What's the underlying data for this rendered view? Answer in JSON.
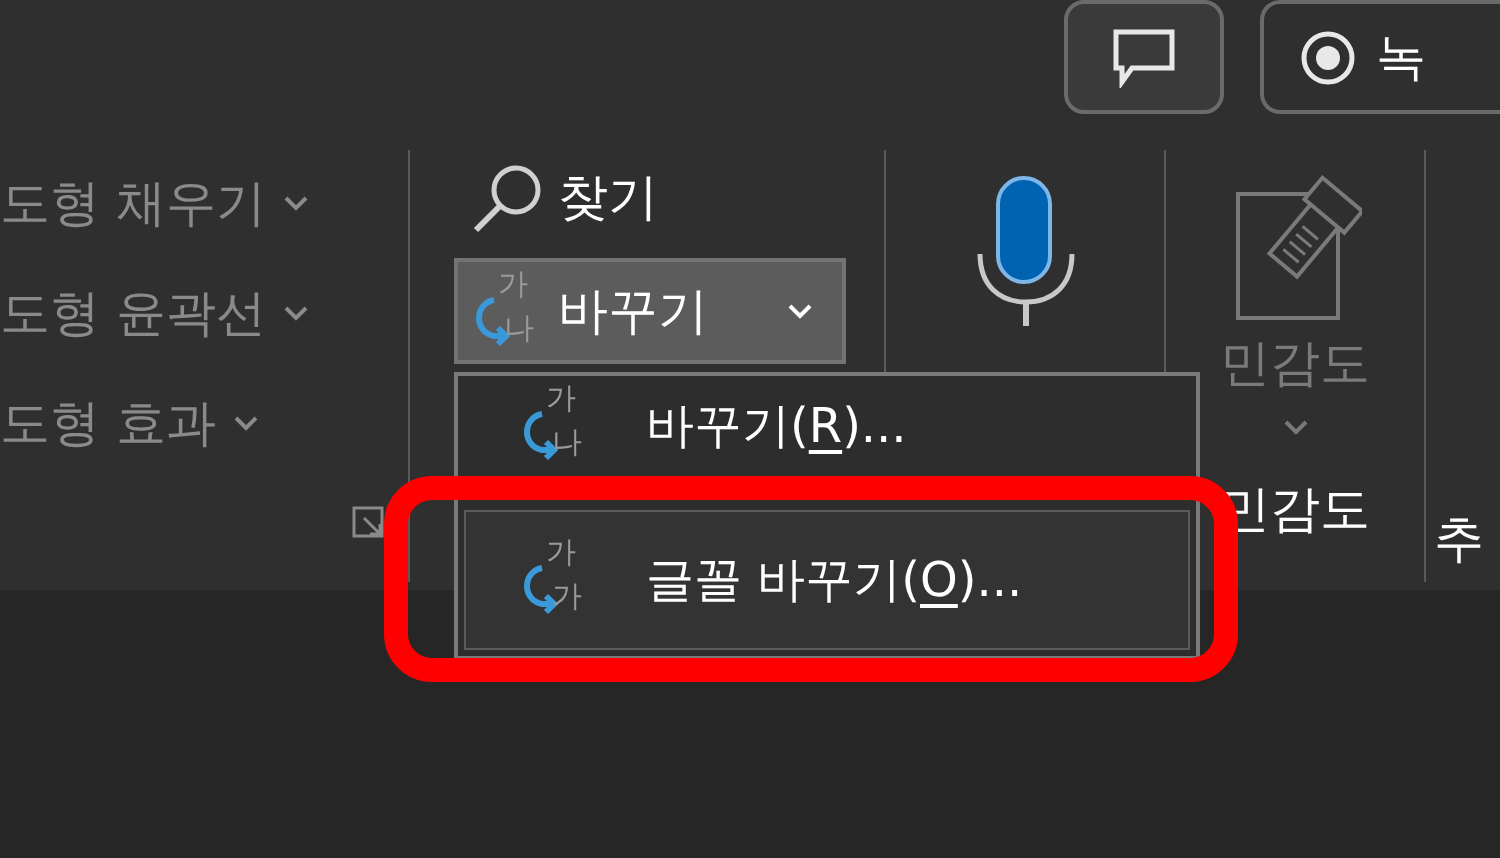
{
  "top_buttons": [
    {
      "kind": "comments"
    },
    {
      "kind": "record",
      "label": "녹"
    }
  ],
  "ribbon": {
    "groups": [
      {
        "kind": "shape_format",
        "items": [
          {
            "label": "도형 채우기",
            "disabled": true
          },
          {
            "label": "도형 윤곽선",
            "disabled": true
          },
          {
            "label": "도형 효과",
            "disabled": true
          }
        ]
      },
      {
        "kind": "editing",
        "find": {
          "label": "찾기"
        },
        "replace": {
          "label": "바꾸기",
          "icon_letters": [
            "가",
            "나"
          ],
          "open": true
        }
      },
      {
        "kind": "dictate"
      },
      {
        "kind": "sensitivity",
        "button": {
          "label": "민감도",
          "disabled": true
        },
        "label": "민감도"
      },
      {
        "kind": "partial",
        "label": "추"
      }
    ]
  },
  "dropdown_menu": {
    "items": [
      {
        "label_start": "바꾸기(",
        "access_key": "R",
        "label_end": ")...",
        "icon_letters": [
          "가",
          "나"
        ],
        "selected": false,
        "highlighted": false
      },
      {
        "label_start": "글꼴 바꾸기(",
        "access_key": "O",
        "label_end": ")...",
        "icon_letters": [
          "가",
          "가"
        ],
        "selected": true,
        "highlighted": true
      }
    ]
  }
}
